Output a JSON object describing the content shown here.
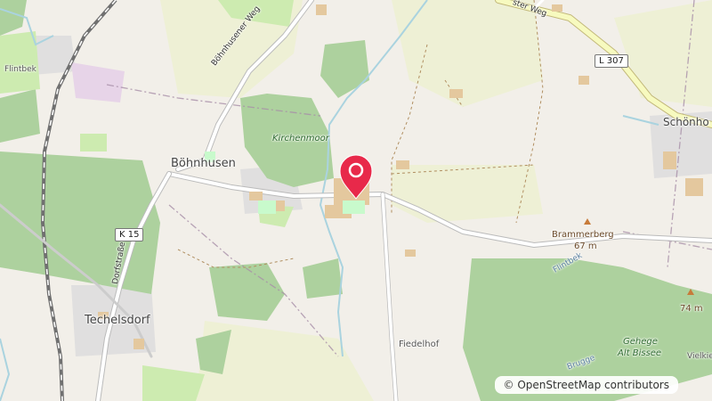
{
  "map": {
    "place_labels": {
      "flintbek_nw": "Flintbek",
      "bohnhusen": "Böhnhusen",
      "techelsdorf": "Techelsdorf",
      "fiedelhof": "Fiedelhof",
      "schoenhorst": "Schönho",
      "vielkie": "Vielkie"
    },
    "nature_labels": {
      "kirchenmoor": "Kirchenmoor",
      "gehege_line1": "Gehege",
      "gehege_line2": "Alt Bissee"
    },
    "road_labels": {
      "bohnhusener_weg": "Böhnhusener Weg",
      "dorfstrasse": "Dorfstraße",
      "ster_weg": "ster Weg",
      "flintbek_stream": "Flintbek",
      "brugge": "Brugge"
    },
    "road_shields": {
      "k15": "K 15",
      "l307": "L 307"
    },
    "peaks": {
      "brammerberg_name": "Brammerberg",
      "brammerberg_elev": "67 m",
      "east_elev": "74 m"
    },
    "attribution": "© OpenStreetMap contributors",
    "marker": {
      "color": "#e8294a"
    },
    "colors": {
      "forest": "#add19e",
      "farmland": "#eef0d5",
      "residential": "#e0dfdf",
      "building": "#e4c89e",
      "water": "#aad3df",
      "road_major": "#f7fabf",
      "rail": "#707070"
    }
  }
}
